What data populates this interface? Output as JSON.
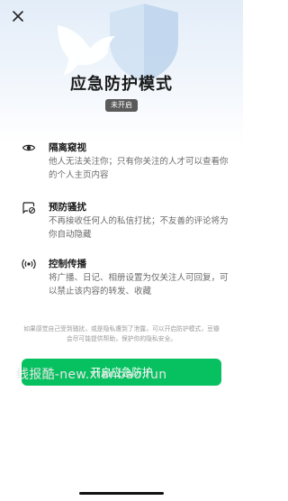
{
  "header": {
    "title": "应急防护模式",
    "status_badge": "未开启"
  },
  "features": [
    {
      "icon": "eye-icon",
      "title": "隔离窥视",
      "desc": "他人无法关注你；只有你关注的人才可以查看你的个人主页内容"
    },
    {
      "icon": "chat-block-icon",
      "title": "预防骚扰",
      "desc": "不再接收任何人的私信打扰；不友善的评论将为你自动隐藏"
    },
    {
      "icon": "broadcast-icon",
      "title": "控制传播",
      "desc": "将广播、日记、相册设置为仅关注人可回复，可以禁止该内容的转发、收藏"
    }
  ],
  "note": "如果感觉自己受到骚扰，或是隐私遭到了泄露，可以开启防护模式，豆瓣会尽可能提供帮助，保护你的隐私安全。",
  "action_button": "开启应急防护",
  "watermark": "线报酷-new.xianbao.fun",
  "colors": {
    "accent": "#07c160",
    "badge": "#5a5a5a",
    "hero_top": "#e3edf8"
  }
}
